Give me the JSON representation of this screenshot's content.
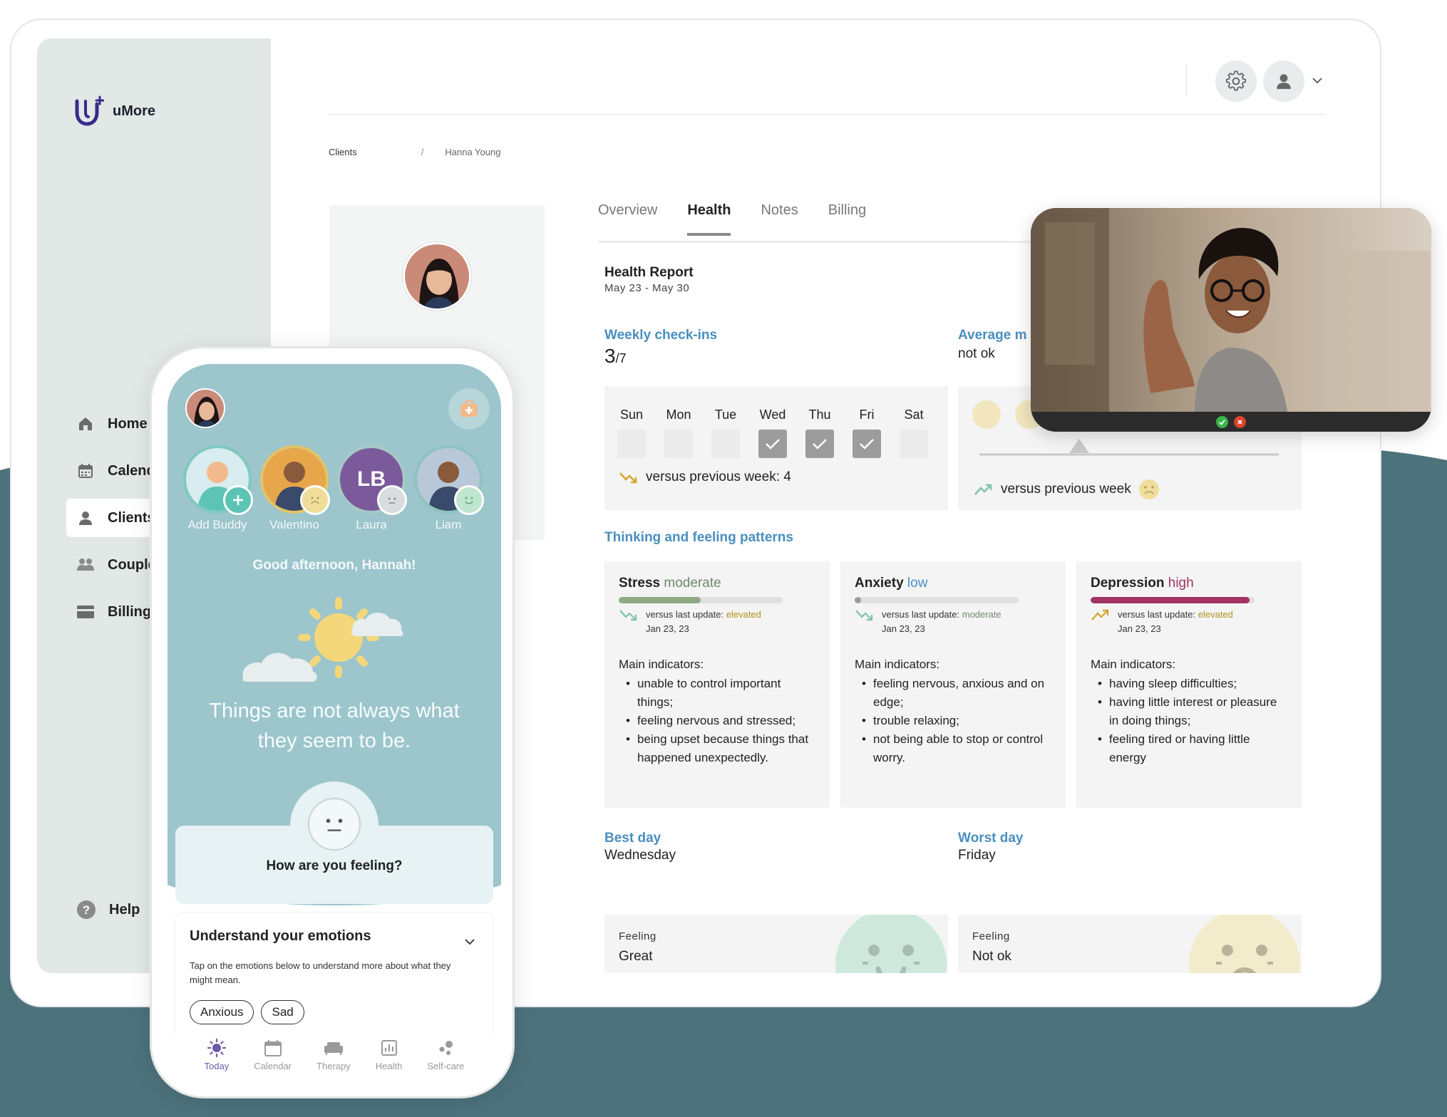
{
  "brand": {
    "name": "uMore",
    "color": "#3b2a8c"
  },
  "colors": {
    "accent_blue": "#4a8fbf",
    "teal_bg": "#4c727b",
    "phone_teal": "#9cc5cc",
    "sidebar_bg": "#e1e8e6"
  },
  "sidebar": {
    "items": [
      {
        "label": "Home",
        "icon": "home-icon"
      },
      {
        "label": "Calend",
        "icon": "calendar-icon"
      },
      {
        "label": "Clients",
        "icon": "person-icon",
        "active": true
      },
      {
        "label": "Couple",
        "icon": "people-icon"
      },
      {
        "label": "Billing",
        "icon": "card-icon"
      }
    ],
    "help": "Help"
  },
  "header": {
    "settings_icon": "gear-icon",
    "profile_icon": "user-icon"
  },
  "breadcrumb": {
    "root": "Clients",
    "separator": "/",
    "current": "Hanna Young"
  },
  "tabs": [
    "Overview",
    "Health",
    "Notes",
    "Billing"
  ],
  "report": {
    "title": "Health Report",
    "range": "May 23 - May 30",
    "weekly": {
      "label": "Weekly check-ins",
      "count": "3",
      "total": "/7",
      "days": [
        "Sun",
        "Mon",
        "Tue",
        "Wed",
        "Thu",
        "Fri",
        "Sat"
      ],
      "checked": [
        false,
        false,
        false,
        true,
        true,
        true,
        false
      ],
      "compare": "versus previous week: 4"
    },
    "average": {
      "label": "Average m",
      "value": "not ok",
      "compare": "versus previous week"
    },
    "patterns_label": "Thinking and feeling patterns",
    "patterns": [
      {
        "name": "Stress",
        "level": "moderate",
        "level_color": "#6f8a6b",
        "fill": 0.5,
        "fill_color": "#8fa985",
        "compare_prefix": "versus last update: ",
        "compare_value": "elevated",
        "compare_color": "#b0901a",
        "date": "Jan 23, 23",
        "main": "Main indicators:",
        "indicators": [
          "unable to control important things;",
          "feeling nervous and stressed;",
          "being upset because things that happened unexpectedly."
        ]
      },
      {
        "name": "Anxiety",
        "level": "low",
        "level_color": "#4a8fbf",
        "fill": 0.04,
        "fill_color": "#9c9c9c",
        "compare_prefix": "versus last update: ",
        "compare_value": "moderate",
        "compare_color": "#6f8a6b",
        "date": "Jan 23, 23",
        "main": "Main indicators:",
        "indicators": [
          "feeling nervous, anxious and on edge;",
          "trouble relaxing;",
          "not being able to stop or control worry."
        ]
      },
      {
        "name": "Depression",
        "level": "high",
        "level_color": "#a23366",
        "fill": 0.97,
        "fill_color": "#a23366",
        "compare_prefix": "versus last update: ",
        "compare_value": "elevated",
        "compare_color": "#b0901a",
        "date": "Jan 23, 23",
        "main": "Main indicators:",
        "indicators": [
          "having sleep difficulties;",
          "having little interest or pleasure in doing things;",
          "feeling tired or having little energy"
        ]
      }
    ],
    "best_day": {
      "label": "Best day",
      "value": "Wednesday",
      "feeling_label": "Feeling",
      "feeling": "Great"
    },
    "worst_day": {
      "label": "Worst day",
      "value": "Friday",
      "feeling_label": "Feeling",
      "feeling": "Not ok"
    }
  },
  "phone": {
    "buddies": [
      {
        "name": "Add Buddy",
        "initials": ""
      },
      {
        "name": "Valentino",
        "initials": ""
      },
      {
        "name": "Laura",
        "initials": "LB"
      },
      {
        "name": "Liam",
        "initials": ""
      }
    ],
    "greeting": "Good afternoon, Hannah!",
    "quote": "Things are not always what they seem to be.",
    "feeling_question": "How are you feeling?",
    "emotions": {
      "title": "Understand your emotions",
      "description": "Tap on the emotions below to understand more about what they might mean.",
      "chips": [
        "Anxious",
        "Sad"
      ]
    },
    "tabbar": [
      {
        "label": "Today",
        "icon": "sun-icon",
        "active": true
      },
      {
        "label": "Calendar",
        "icon": "calendar-icon"
      },
      {
        "label": "Therapy",
        "icon": "couch-icon"
      },
      {
        "label": "Health",
        "icon": "chart-icon"
      },
      {
        "label": "Self-care",
        "icon": "dots-icon"
      }
    ]
  }
}
